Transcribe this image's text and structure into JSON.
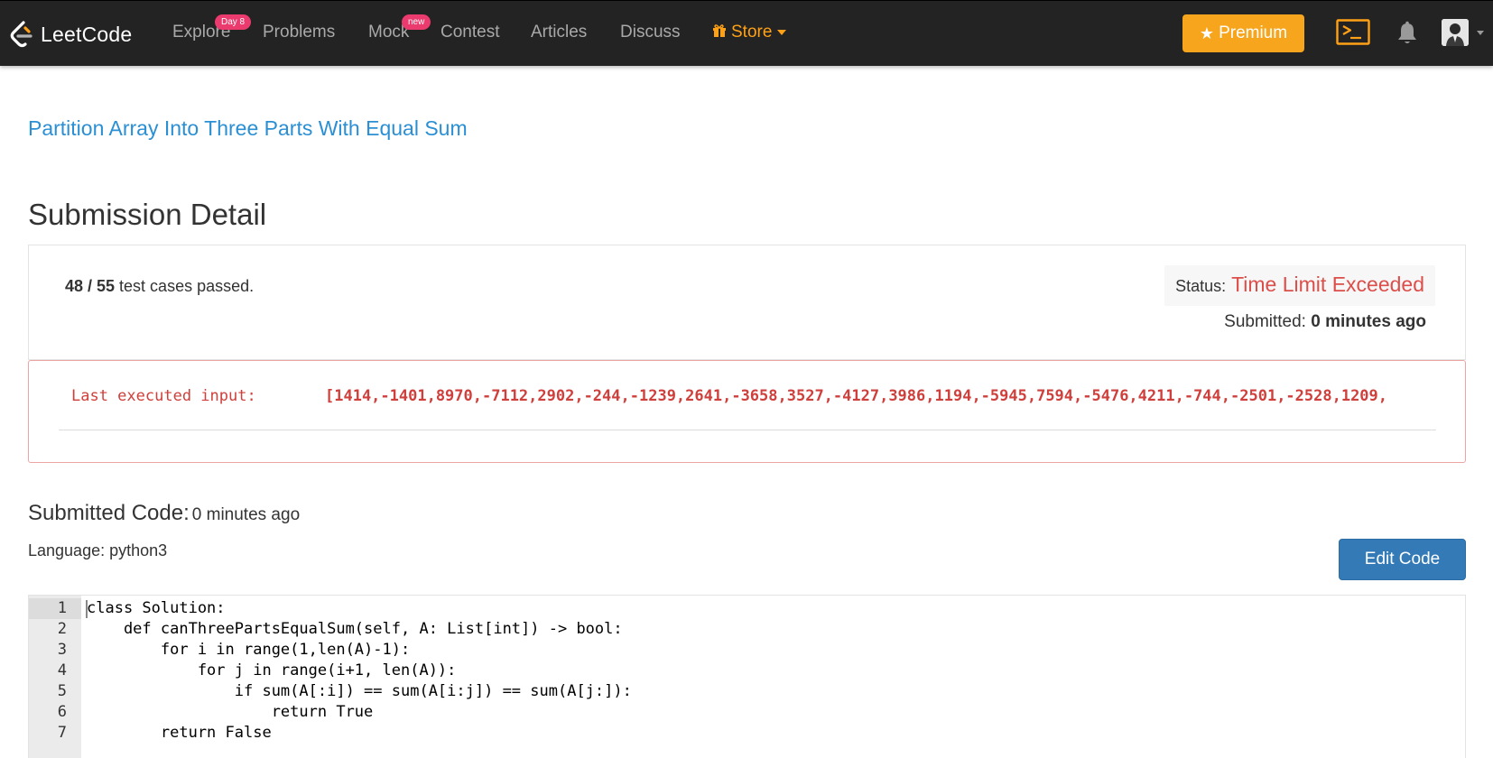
{
  "navbar": {
    "brand": "LeetCode",
    "items": [
      {
        "label": "Explore",
        "badge": "Day 8"
      },
      {
        "label": "Problems"
      },
      {
        "label": "Mock",
        "badge": "new"
      },
      {
        "label": "Contest"
      },
      {
        "label": "Articles"
      },
      {
        "label": "Discuss"
      },
      {
        "label": "Store"
      }
    ],
    "premium_label": "Premium",
    "icons": [
      "leetcode-logo",
      "gift-icon",
      "star-icon",
      "console-icon",
      "bell-icon",
      "avatar"
    ],
    "colors": {
      "background": "#232323",
      "store": "#ffa116",
      "premium": "#f7a51c",
      "badge": "#ea3a6e"
    }
  },
  "problem_title": "Partition Array Into Three Parts With Equal Sum",
  "page_title": "Submission Detail",
  "summary": {
    "passed_count": "48 / 55",
    "passed_suffix": " test cases passed.",
    "status_label": "Status:",
    "status_value": "Time Limit Exceeded",
    "submitted_label": "Submitted:",
    "submitted_value": "0 minutes ago"
  },
  "error": {
    "label": "Last executed input:",
    "value": "[1414,-1401,8970,-7112,2902,-244,-1239,2641,-3658,3527,-4127,3986,1194,-5945,7594,-5476,4211,-744,-2501,-2528,1209,"
  },
  "code_section": {
    "heading": "Submitted Code:",
    "time": "0 minutes ago",
    "language_label": "Language:",
    "language": "python3",
    "edit_label": "Edit Code"
  },
  "code": {
    "line_numbers": [
      "1",
      "2",
      "3",
      "4",
      "5",
      "6",
      "7"
    ],
    "lines": [
      "class Solution:",
      "    def canThreePartsEqualSum(self, A: List[int]) -> bool:",
      "        for i in range(1,len(A)-1):",
      "            for j in range(i+1, len(A)):",
      "                if sum(A[:i]) == sum(A[i:j]) == sum(A[j:]):",
      "                    return True",
      "        return False"
    ]
  },
  "colors": {
    "link": "#2b8fd4",
    "error": "#dc4e4a",
    "edit_button": "#337ab7"
  }
}
